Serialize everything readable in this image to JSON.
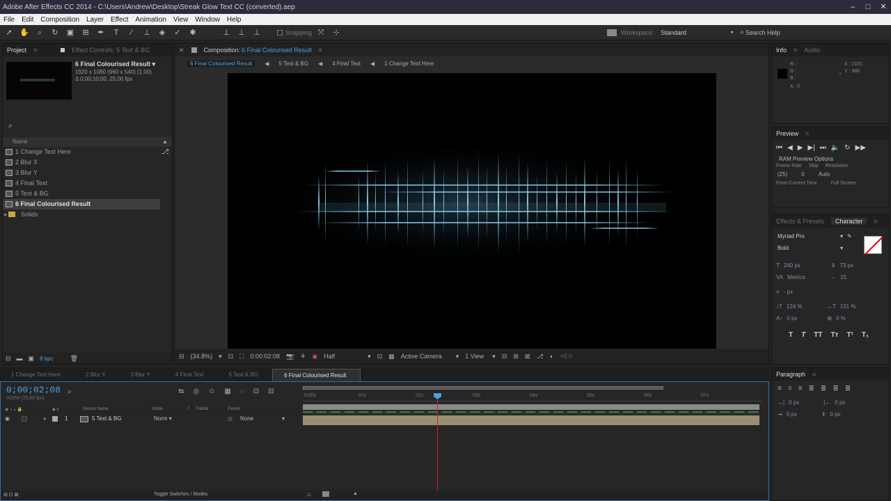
{
  "window": {
    "title": "Adobe After Effects CC 2014 - C:\\Users\\Andrew\\Desktop\\Streak Glow Text CC (converted).aep",
    "controls": [
      "–",
      "□",
      "✕"
    ]
  },
  "menu": [
    "File",
    "Edit",
    "Composition",
    "Layer",
    "Effect",
    "Animation",
    "View",
    "Window",
    "Help"
  ],
  "toolbar": {
    "snapping_label": "Snapping",
    "workspace_label": "Workspace:",
    "workspace_value": "Standard",
    "search_placeholder": "Search Help"
  },
  "project": {
    "tabs": [
      "Project",
      "Effect Controls: 5 Text & BG"
    ],
    "selected_name": "6 Final Colourised Result ▾",
    "selected_dims": "1920 x 1080 (960 x 540) (1.00)",
    "selected_dur": "Δ 0;00;10;00, 25.00 fps",
    "column_name": "Name",
    "items": [
      {
        "label": "1 Change Text Here"
      },
      {
        "label": "2 Blur X"
      },
      {
        "label": "3 Blur Y"
      },
      {
        "label": "4 Final Text"
      },
      {
        "label": "5 Text & BG"
      },
      {
        "label": "6 Final Colourised Result"
      },
      {
        "label": "Solids"
      }
    ],
    "bpc": "8 bpc"
  },
  "composition": {
    "tab_label": "Composition:",
    "tab_name": "6 Final Colourised Result",
    "breadcrumbs": [
      "6 Final Colourised Result",
      "5 Text & BG",
      "4 Final Text",
      "1 Change Text Here"
    ],
    "zoom": "(34.8%)",
    "timecode": "0:00:02:08",
    "resolution": "Half",
    "camera": "Active Camera",
    "views": "1 View",
    "exposure": "+0.0"
  },
  "info": {
    "tabs": [
      "Info",
      "Audio"
    ],
    "r": "R :",
    "g": "G :",
    "b": "B :",
    "a": "A : 0",
    "x": "X : 2101",
    "y": "Y : 388"
  },
  "preview": {
    "tab": "Preview",
    "options_label": "RAM Preview Options",
    "frame_rate_label": "Frame Rate",
    "skip_label": "Skip",
    "resolution_label": "Resolution",
    "frame_rate_value": "(25)",
    "skip_value": "0",
    "resolution_value": "Auto",
    "from_current": "From Current Time",
    "full_screen": "Full Screen"
  },
  "character": {
    "tabs": [
      "Effects & Presets",
      "Character"
    ],
    "font": "Myriad Pro",
    "style": "Bold",
    "size": "240 px",
    "leading": "73 px",
    "kerning": "Metrics",
    "tracking": "15",
    "stroke": "- px",
    "vscale": "124 %",
    "hscale": "131 %",
    "baseline": "0 px",
    "tsume": "0 %"
  },
  "paragraph": {
    "tab": "Paragraph",
    "indent_left": "0 px",
    "indent_right": "0 px",
    "indent_first": "0 px",
    "space_before": "0 px",
    "space_after": "0 px"
  },
  "timeline": {
    "tabs": [
      "1 Change Text Here",
      "2 Blur X",
      "3 Blur Y",
      "4 Final Text",
      "5 Text & BG",
      "6 Final Colourised Result"
    ],
    "timecode": "0;00;02;08",
    "frame_info": "00058 (25.00 fps)",
    "col_source": "Source Name",
    "col_mode": "Mode",
    "col_t": "T",
    "col_trkmat": "TrkMat",
    "col_parent": "Parent",
    "layer_num": "1",
    "layer_name": "5 Text & BG",
    "layer_mode": "Norm ▾",
    "layer_parent": "None",
    "ruler": [
      "0:00s",
      "01s",
      "02s",
      "03s",
      "04s",
      "05s",
      "06s",
      "07s"
    ],
    "toggle_label": "Toggle Switches / Modes"
  },
  "colors": {
    "accent": "#4aa0e0",
    "streak": "#7fd0ee",
    "playhead": "#d02020"
  }
}
